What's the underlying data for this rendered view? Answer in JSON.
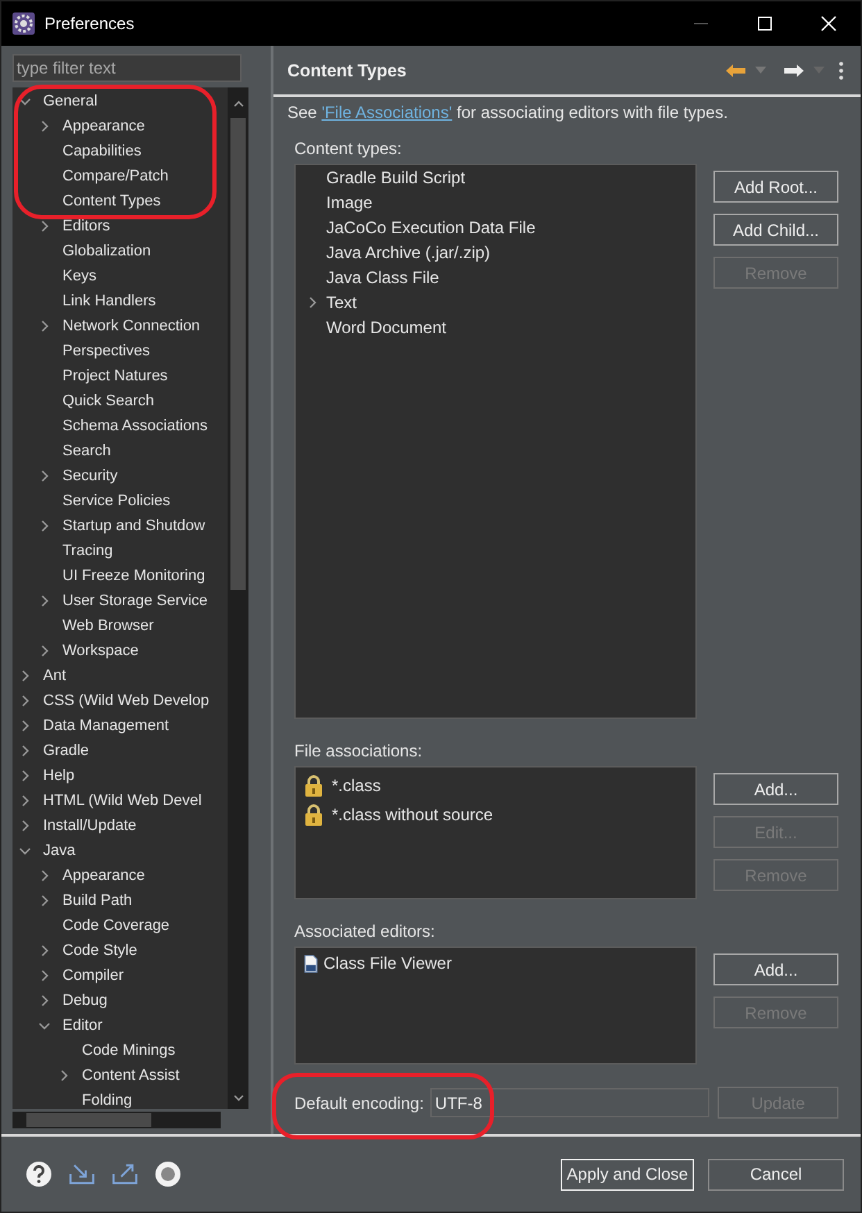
{
  "window": {
    "title": "Preferences"
  },
  "sidebar": {
    "filter": {
      "placeholder": "type filter text"
    },
    "tree": [
      {
        "label": "General",
        "expanded": true,
        "children": [
          {
            "label": "Appearance",
            "expanded": false
          },
          {
            "label": "Capabilities"
          },
          {
            "label": "Compare/Patch"
          },
          {
            "label": "Content Types"
          },
          {
            "label": "Editors",
            "expanded": false
          },
          {
            "label": "Globalization"
          },
          {
            "label": "Keys"
          },
          {
            "label": "Link Handlers"
          },
          {
            "label": "Network Connection",
            "expanded": false
          },
          {
            "label": "Perspectives"
          },
          {
            "label": "Project Natures"
          },
          {
            "label": "Quick Search"
          },
          {
            "label": "Schema Associations"
          },
          {
            "label": "Search"
          },
          {
            "label": "Security",
            "expanded": false
          },
          {
            "label": "Service Policies"
          },
          {
            "label": "Startup and Shutdow",
            "expanded": false
          },
          {
            "label": "Tracing"
          },
          {
            "label": "UI Freeze Monitoring"
          },
          {
            "label": "User Storage Service",
            "expanded": false
          },
          {
            "label": "Web Browser"
          },
          {
            "label": "Workspace",
            "expanded": false
          }
        ]
      },
      {
        "label": "Ant",
        "expanded": false
      },
      {
        "label": "CSS (Wild Web Develop",
        "expanded": false
      },
      {
        "label": "Data Management",
        "expanded": false
      },
      {
        "label": "Gradle",
        "expanded": false
      },
      {
        "label": "Help",
        "expanded": false
      },
      {
        "label": "HTML (Wild Web Devel",
        "expanded": false
      },
      {
        "label": "Install/Update",
        "expanded": false
      },
      {
        "label": "Java",
        "expanded": true,
        "children": [
          {
            "label": "Appearance",
            "expanded": false
          },
          {
            "label": "Build Path",
            "expanded": false
          },
          {
            "label": "Code Coverage"
          },
          {
            "label": "Code Style",
            "expanded": false
          },
          {
            "label": "Compiler",
            "expanded": false
          },
          {
            "label": "Debug",
            "expanded": false
          },
          {
            "label": "Editor",
            "expanded": true,
            "children": [
              {
                "label": "Code Minings"
              },
              {
                "label": "Content Assist",
                "expanded": false
              },
              {
                "label": "Folding"
              }
            ]
          }
        ]
      }
    ]
  },
  "page": {
    "title": "Content Types",
    "description": {
      "prefix": "See ",
      "link": "'File Associations'",
      "suffix": " for associating editors with file types."
    }
  },
  "content_types": {
    "label": "Content types:",
    "items": [
      {
        "label": "Gradle Build Script"
      },
      {
        "label": "Image"
      },
      {
        "label": "JaCoCo Execution Data File"
      },
      {
        "label": "Java Archive (.jar/.zip)"
      },
      {
        "label": "Java Class File"
      },
      {
        "label": "Text",
        "expanded": false
      },
      {
        "label": "Word Document"
      }
    ],
    "buttons": [
      {
        "label": "Add Root...",
        "disabled": false
      },
      {
        "label": "Add Child...",
        "disabled": false
      },
      {
        "label": "Remove",
        "disabled": true
      }
    ]
  },
  "file_associations": {
    "label": "File associations:",
    "items": [
      {
        "label": "*.class"
      },
      {
        "label": "*.class without source"
      }
    ],
    "buttons": [
      {
        "label": "Add...",
        "disabled": false
      },
      {
        "label": "Edit...",
        "disabled": true
      },
      {
        "label": "Remove",
        "disabled": true
      }
    ]
  },
  "associated_editors": {
    "label": "Associated editors:",
    "items": [
      {
        "label": "Class File Viewer"
      }
    ],
    "buttons": [
      {
        "label": "Add...",
        "disabled": false
      },
      {
        "label": "Remove",
        "disabled": true
      }
    ]
  },
  "encoding": {
    "label": "Default encoding:",
    "value": "UTF-8",
    "button": {
      "label": "Update",
      "disabled": true
    }
  },
  "footer": {
    "buttons": [
      {
        "label": "Apply and Close",
        "default": true
      },
      {
        "label": "Cancel",
        "default": false
      }
    ]
  }
}
